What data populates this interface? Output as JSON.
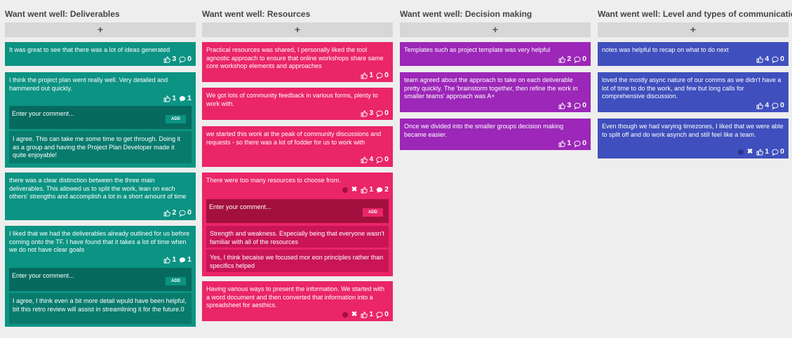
{
  "columns": [
    {
      "title": "Want went well: Deliverables",
      "add_label": "+",
      "cards": [
        {
          "text": "It was great to see that there was a lot of ideas generated",
          "likes": "3",
          "comments": "0"
        },
        {
          "text": "I think the project plan went really well. Very detailed and hammered out quickly.",
          "likes": "1",
          "comments": "1",
          "comment_placeholder": "Enter your comment...",
          "add_button": "ADD",
          "replies": [
            "I agree. This can take me some time to get through. Doing it as a group and having the Project Plan Developer made it quite enjoyable!"
          ]
        },
        {
          "text": "there was a clear distinction between the three main deliverables. This allowed us to split the work, lean on each others' strengths and accomplish a lot in a short amount of time",
          "likes": "2",
          "comments": "0"
        },
        {
          "text": "I liked that we had the deliverables already outlined for us before coming onto the TF. I have found that it takes a lot of time when we do not have clear goals",
          "likes": "1",
          "comments": "1",
          "comment_placeholder": "Enter your comment...",
          "add_button": "ADD",
          "replies": [
            "I agree, I think even a bit more detail wpuld have been helpful, bit this retro review will assist in streamlining it for the future.0"
          ]
        }
      ]
    },
    {
      "title": "Want went well: Resources",
      "add_label": "+",
      "cards": [
        {
          "text": "Practical resources was shared, I personally liked the tool agnostic approach to ensure that online workshops share same core workshop elements and approaches",
          "likes": "1",
          "comments": "0"
        },
        {
          "text": "We got lots of community feedback in various forms, plenty to work with.",
          "likes": "3",
          "comments": "0"
        },
        {
          "text": "we started this work at the peak of community discussions and requests - so there was a lot of fodder for us to work with",
          "likes": "4",
          "comments": "0"
        },
        {
          "text": "There were too many resources to choose from.",
          "likes": "1",
          "comments": "2",
          "comment_placeholder": "Enter your comment...",
          "add_button": "ADD",
          "replies": [
            "Strength and weakness. Especially being that everyone wasn't familiar with all of the resources",
            "Yes, I think becaise we focused mor eon principles rather than specifics helped"
          ]
        },
        {
          "text": "Having various ways to present the information. We started with a word document and then converted that information into a spreadsheet for aesthics.",
          "likes": "1",
          "comments": "0"
        }
      ]
    },
    {
      "title": "Want went well: Decision making",
      "add_label": "+",
      "cards": [
        {
          "text": "Templates such as project template was very helpful",
          "likes": "2",
          "comments": "0"
        },
        {
          "text": "team agreed about the approach to take on each deliverable pretty quickly. The 'brainstorm together, then refine the work in smaller teams' approach was A+",
          "likes": "3",
          "comments": "0"
        },
        {
          "text": "Once we divided into the smaller groups decision making became easier.",
          "likes": "1",
          "comments": "0"
        }
      ]
    },
    {
      "title": "Want went well: Level and types of communication",
      "add_label": "+",
      "cards": [
        {
          "text": "notes was helpful to recap on what to do next",
          "likes": "4",
          "comments": "0"
        },
        {
          "text": "loved the mostly async nature of our comms as we didn't have a lot of time to do the work, and few but long calls for comprehensive discussion.",
          "likes": "4",
          "comments": "0"
        },
        {
          "text": "Even though we had varying timezones, I liked that we were able to split off and do work asynch and still feel like a team.",
          "likes": "1",
          "comments": "0"
        }
      ]
    }
  ],
  "icons": {
    "like": "thumbs-up-icon",
    "comment": "speech-bubble-icon",
    "delete": "close-icon",
    "color": "color-dot-icon"
  },
  "colors": {
    "deliverables": "#0b9383",
    "resources": "#ea2568",
    "decision": "#9c27b8",
    "communication": "#3f4fbd",
    "add_bar": "#d7d7d7",
    "background": "#eeeeee"
  }
}
